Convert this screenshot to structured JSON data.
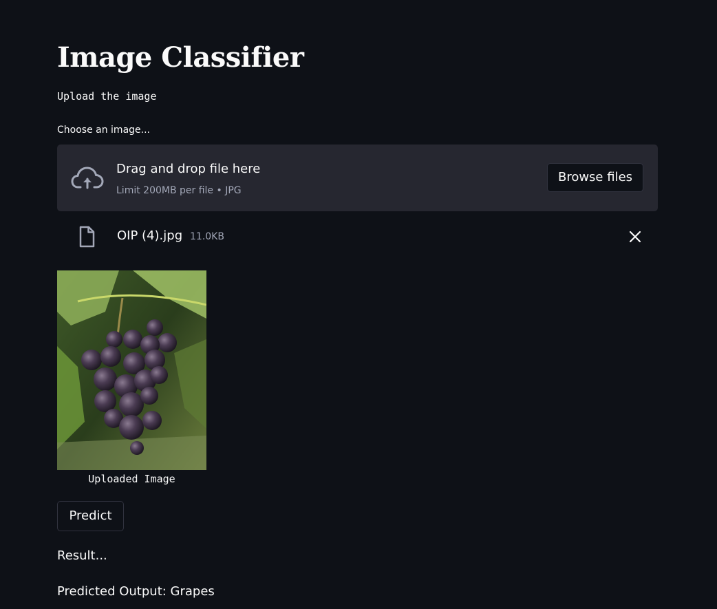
{
  "header": {
    "title": "Image Classifier",
    "subtitle": "Upload the image"
  },
  "uploader": {
    "label": "Choose an image...",
    "dropzone_title": "Drag and drop file here",
    "dropzone_limit": "Limit 200MB per file • JPG",
    "browse_label": "Browse files",
    "upload_icon": "cloud-upload-icon"
  },
  "uploaded_file": {
    "name": "OIP (4).jpg",
    "size": "11.0KB",
    "file_icon": "file-icon",
    "remove_icon": "close-icon"
  },
  "preview": {
    "caption": "Uploaded Image"
  },
  "actions": {
    "predict_label": "Predict"
  },
  "result": {
    "label": "Result...",
    "output": "Predicted Output: Grapes"
  },
  "colors": {
    "background": "#0e1117",
    "dropzone": "#262730",
    "text": "#fafafa",
    "muted": "#a3a8b8",
    "border": "#31333f"
  }
}
